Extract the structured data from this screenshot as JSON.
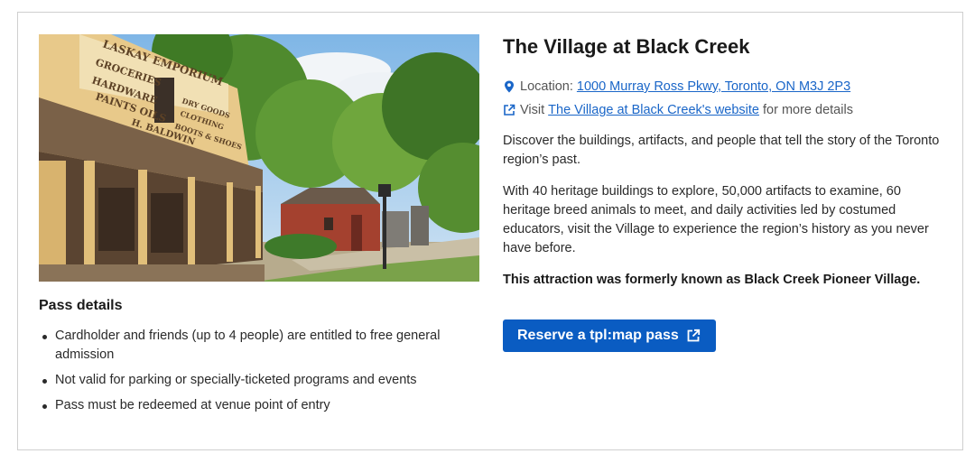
{
  "attraction": {
    "title": "The Village at Black Creek",
    "location_label": "Location:",
    "location_link": "1000 Murray Ross Pkwy, Toronto, ON M3J 2P3",
    "visit_prefix": "Visit",
    "website_link": "The Village at Black Creek's website",
    "visit_suffix": "for more details",
    "description_1": "Discover the buildings, artifacts, and people that tell the story of the Toronto region’s past.",
    "description_2": "With 40 heritage buildings to explore, 50,000 artifacts to examine, 60 heritage breed animals to meet, and daily activities led by costumed educators, visit the Village to experience the region’s history as you never have before.",
    "former_name_note": "This attraction was formerly known as Black Creek Pioneer Village.",
    "reserve_button": "Reserve a tpl:map pass"
  },
  "photo": {
    "sign_text": [
      "LASKAY EMPORIUM",
      "GROCERIES",
      "HARDWARE",
      "PAINTS OILS",
      "H. BALDWIN",
      "DRY GOODS",
      "CLOTHING",
      "BOOTS & SHOES"
    ]
  },
  "pass_details": {
    "heading": "Pass details",
    "items": [
      "Cardholder and friends (up to 4 people) are entitled to free general admission",
      "Not valid for parking or specially-ticketed programs and events",
      "Pass must be redeemed at venue point of entry"
    ]
  },
  "icons": {
    "location": "map-pin-icon",
    "external": "external-link-icon"
  },
  "colors": {
    "link": "#1a66c8",
    "button": "#0a5cc2"
  }
}
